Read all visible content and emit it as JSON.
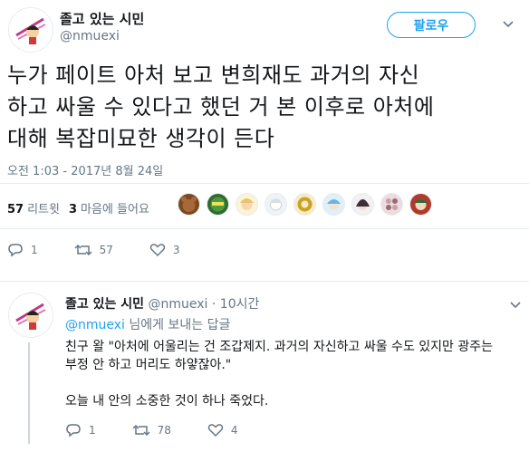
{
  "tweet": {
    "display_name": "졸고 있는 시민",
    "handle": "@nmuexi",
    "follow_label": "팔로우",
    "text_lines": [
      "누가 페이트 아처 보고 변희재도 과거의 자신",
      "하고 싸울 수 있다고 했던 거 본 이후로 아처에",
      "대해 복잡미묘한 생각이 든다"
    ],
    "timestamp": "오전 1:03 - 2017년 8월 24일",
    "retweet_count": "57",
    "retweet_label": "리트윗",
    "like_count": "3",
    "like_label": "마음에 들어요",
    "actions": {
      "reply": "1",
      "retweet": "57",
      "like": "3"
    }
  },
  "likers": [
    {
      "icon": "bear-avatar",
      "color": "#7a4a1e"
    },
    {
      "icon": "green-logo-avatar",
      "color": "#2e6b2e"
    },
    {
      "icon": "yellow-character-avatar",
      "color": "#e8c36a"
    },
    {
      "icon": "white-character-avatar",
      "color": "#dfe6ec"
    },
    {
      "icon": "gold-emblem-avatar",
      "color": "#c9a227"
    },
    {
      "icon": "blue-character-avatar",
      "color": "#6ab3e8"
    },
    {
      "icon": "dark-hair-avatar",
      "color": "#3a2f3a"
    },
    {
      "icon": "pink-pattern-avatar",
      "color": "#c9a0a8"
    },
    {
      "icon": "red-green-avatar",
      "color": "#b23a2a"
    }
  ],
  "reply": {
    "display_name": "졸고 있는 시민",
    "handle": "@nmuexi",
    "separator": "·",
    "time": "10시간",
    "reply_to_handle": "@nmuexi",
    "reply_to_suffix": "님에게 보내는 답글",
    "text_lines": [
      "친구 왈 \"아처에 어울리는 건 조갑제지. 과거의 자신하고 싸울 수도 있지만 광주는",
      "부정 안 하고 머리도 하얗잖아.\""
    ],
    "text_line_3": "오늘 내 안의 소중한 것이 하나 죽었다.",
    "actions": {
      "reply": "1",
      "retweet": "78",
      "like": "4"
    }
  },
  "colors": {
    "accent": "#1da1f2",
    "muted": "#657786",
    "text": "#14171a",
    "border": "#e6ecf0"
  }
}
